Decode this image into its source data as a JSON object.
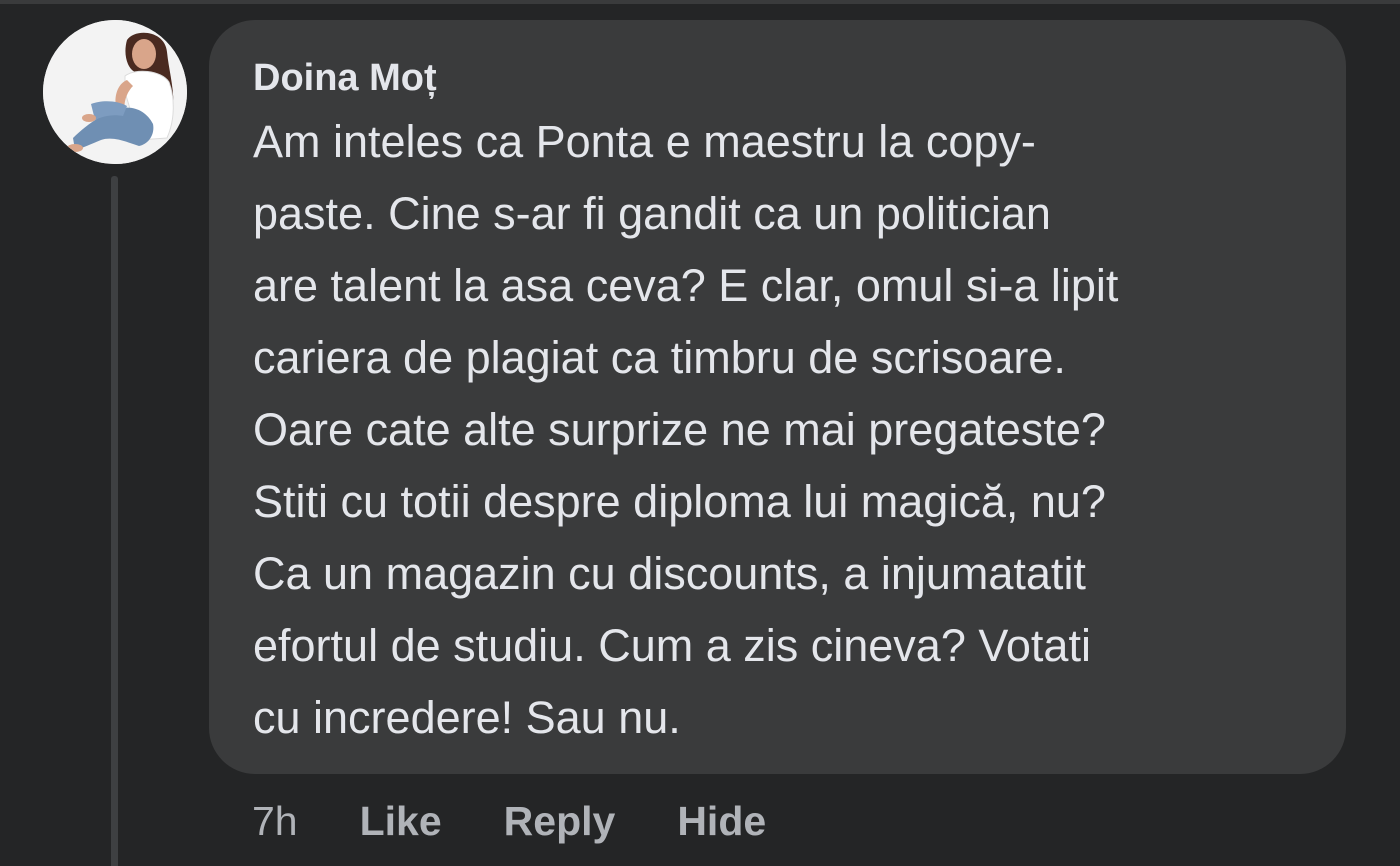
{
  "comment": {
    "author": "Doina Moț",
    "avatar_icon": "profile-photo",
    "lines": [
      "Am inteles ca Ponta e maestru la copy-",
      "paste. Cine s-ar fi gandit ca un politician",
      "are talent la asa ceva? E clar, omul si-a lipit",
      "cariera de plagiat ca timbru de scrisoare.",
      "Oare cate alte surprize ne mai pregateste?",
      "Stiti cu totii despre diploma lui magică, nu?",
      "Ca un magazin cu discounts, a injumatatit",
      "efortul de studiu. Cum a zis cineva? Votati",
      "cu incredere! Sau nu."
    ],
    "time": "7h",
    "actions": {
      "like": "Like",
      "reply": "Reply",
      "hide": "Hide"
    }
  },
  "colors": {
    "background": "#242526",
    "bubble": "#3a3b3c",
    "text": "#e4e6eb",
    "secondary_text": "#b0b3b8"
  }
}
